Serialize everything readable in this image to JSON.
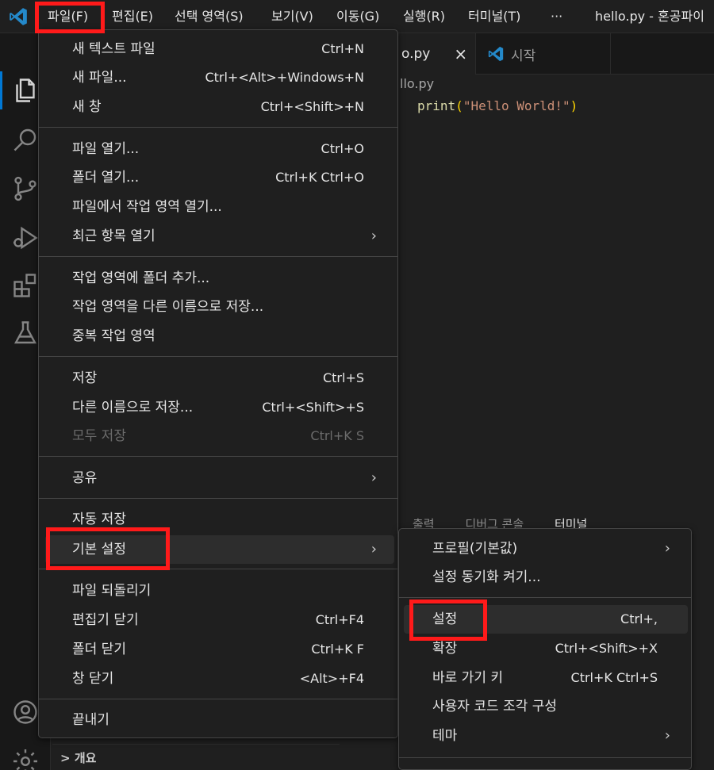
{
  "menubar": {
    "items": [
      "파일(F)",
      "편집(E)",
      "선택 영역(S)",
      "보기(V)",
      "이동(G)",
      "실행(R)",
      "터미널(T)",
      "···"
    ],
    "window_title": "hello.py - 혼공파이"
  },
  "editor": {
    "active_tab": "o.py",
    "inactive_tab": "시작",
    "breadcrumb": "llo.py",
    "code": {
      "fn": "print",
      "open": "(",
      "string": "\"Hello World!\"",
      "close": ")"
    }
  },
  "panel": {
    "tabs": [
      "출력",
      "디버그 콘솔",
      "터미널"
    ]
  },
  "outline": {
    "label": "개요"
  },
  "file_menu": {
    "groups": [
      [
        {
          "label": "새 텍스트 파일",
          "kb": "Ctrl+N"
        },
        {
          "label": "새 파일...",
          "kb": "Ctrl+<Alt>+Windows+N"
        },
        {
          "label": "새 창",
          "kb": "Ctrl+<Shift>+N"
        }
      ],
      [
        {
          "label": "파일 열기...",
          "kb": "Ctrl+O"
        },
        {
          "label": "폴더 열기...",
          "kb": "Ctrl+K Ctrl+O"
        },
        {
          "label": "파일에서 작업 영역 열기...",
          "kb": ""
        },
        {
          "label": "최근 항목 열기",
          "kb": "",
          "submenu": true
        }
      ],
      [
        {
          "label": "작업 영역에 폴더 추가...",
          "kb": ""
        },
        {
          "label": "작업 영역을 다른 이름으로 저장...",
          "kb": ""
        },
        {
          "label": "중복 작업 영역",
          "kb": ""
        }
      ],
      [
        {
          "label": "저장",
          "kb": "Ctrl+S"
        },
        {
          "label": "다른 이름으로 저장...",
          "kb": "Ctrl+<Shift>+S"
        },
        {
          "label": "모두 저장",
          "kb": "Ctrl+K S",
          "disabled": true
        }
      ],
      [
        {
          "label": "공유",
          "kb": "",
          "submenu": true
        }
      ],
      [
        {
          "label": "자동 저장",
          "kb": ""
        },
        {
          "label": "기본 설정",
          "kb": "",
          "submenu": true,
          "active": true
        }
      ],
      [
        {
          "label": "파일 되돌리기",
          "kb": ""
        },
        {
          "label": "편집기 닫기",
          "kb": "Ctrl+F4"
        },
        {
          "label": "폴더 닫기",
          "kb": "Ctrl+K F"
        },
        {
          "label": "창 닫기",
          "kb": "<Alt>+F4"
        }
      ],
      [
        {
          "label": "끝내기",
          "kb": ""
        }
      ]
    ]
  },
  "pref_menu": {
    "groups": [
      [
        {
          "label": "프로필(기본값)",
          "kb": "",
          "submenu": true
        },
        {
          "label": "설정 동기화 켜기...",
          "kb": ""
        }
      ],
      [
        {
          "label": "설정",
          "kb": "Ctrl+,",
          "active": true
        },
        {
          "label": "확장",
          "kb": "Ctrl+<Shift>+X"
        },
        {
          "label": "바로 가기 키",
          "kb": "Ctrl+K Ctrl+S"
        },
        {
          "label": "사용자 코드 조각 구성",
          "kb": ""
        },
        {
          "label": "테마",
          "kb": "",
          "submenu": true
        }
      ]
    ]
  },
  "icons": {
    "chevron": "›",
    "close": "×",
    "outline_chevron": ">"
  },
  "colors": {
    "accent": "#0078d4",
    "highlight": "#ff1a1a"
  }
}
